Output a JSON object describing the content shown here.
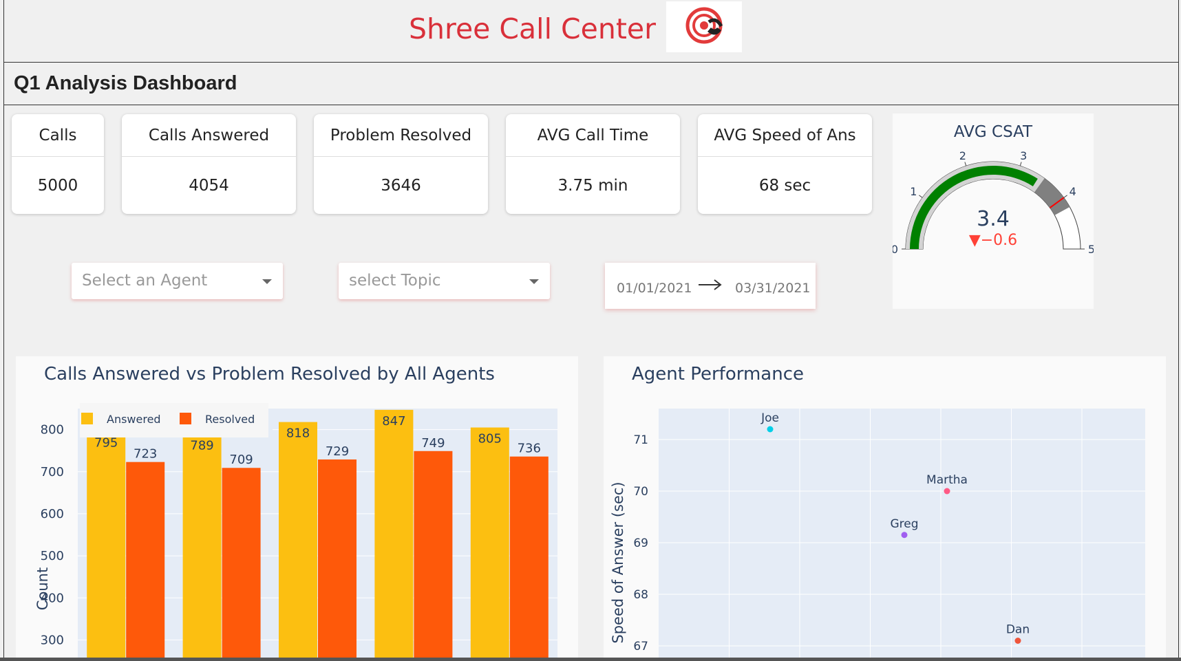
{
  "header": {
    "title": "Shree Call Center",
    "logo_icon": "target-phone-icon"
  },
  "page": {
    "title": "Q1 Analysis Dashboard"
  },
  "kpis": [
    {
      "label": "Calls",
      "value": "5000"
    },
    {
      "label": "Calls Answered",
      "value": "4054"
    },
    {
      "label": "Problem Resolved",
      "value": "3646"
    },
    {
      "label": "AVG Call Time",
      "value": "3.75 min"
    },
    {
      "label": "AVG Speed of Ans",
      "value": "68 sec"
    }
  ],
  "gauge": {
    "title": "AVG CSAT",
    "value": "3.4",
    "delta": "▼−0.6",
    "value_num": 3.4,
    "reference": 4,
    "range": [
      0,
      5
    ],
    "ticks": [
      "0",
      "1",
      "2",
      "3",
      "4",
      "5"
    ],
    "steps": [
      [
        0,
        3.5,
        "#d3d3d3"
      ],
      [
        3.5,
        4.2,
        "#808080"
      ]
    ],
    "bar_color": "#008000",
    "threshold_color": "#ff0000"
  },
  "filters": {
    "agent_placeholder": "Select an Agent",
    "topic_placeholder": "select Topic",
    "date_start": "01/01/2021",
    "date_end": "03/31/2021"
  },
  "charts": {
    "bar_title": "Calls Answered vs Problem Resolved by All Agents",
    "scatter_title": "Agent Performance",
    "legend_answered": "Answered",
    "legend_resolved": "Resolved"
  },
  "chart_data": [
    {
      "type": "bar",
      "title": "Calls Answered vs Problem Resolved by All Agents",
      "xlabel": "",
      "ylabel": "Count",
      "ylim": [
        250,
        850
      ],
      "yticks": [
        300,
        400,
        500,
        600,
        700,
        800
      ],
      "legend": "top-left",
      "series": [
        {
          "name": "Answered",
          "values": [
            795,
            789,
            818,
            847,
            805
          ],
          "color": "#fcbf11"
        },
        {
          "name": "Resolved",
          "values": [
            723,
            709,
            729,
            749,
            736
          ],
          "color": "#fe590a"
        }
      ]
    },
    {
      "type": "scatter",
      "title": "Agent Performance",
      "ylabel": "Speed of Answer (sec)",
      "ylim": [
        66.8,
        71.6
      ],
      "yticks": [
        67,
        68,
        69,
        70,
        71
      ],
      "points": [
        {
          "label": "Joe",
          "y": 71.2,
          "color": "#00cfe8"
        },
        {
          "label": "Martha",
          "y": 70.0,
          "color": "#ff5a85"
        },
        {
          "label": "Greg",
          "y": 69.15,
          "color": "#a05ef0"
        },
        {
          "label": "Dan",
          "y": 67.1,
          "color": "#ef553b"
        }
      ]
    }
  ]
}
